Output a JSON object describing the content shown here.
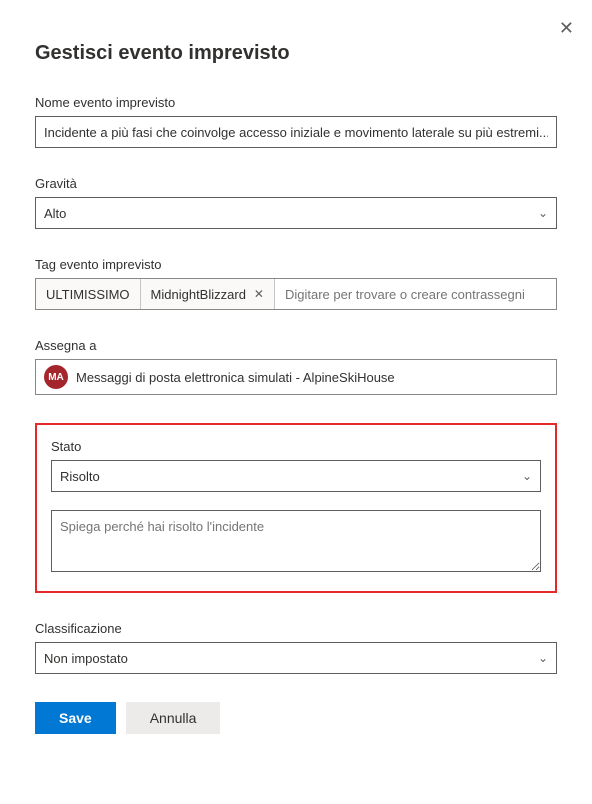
{
  "title": "Gestisci evento imprevisto",
  "name": {
    "label": "Nome evento imprevisto",
    "value": "Incidente a più fasi che coinvolge accesso iniziale e movimento laterale su più estremi..."
  },
  "severity": {
    "label": "Gravità",
    "value": "Alto"
  },
  "tags": {
    "label": "Tag evento imprevisto",
    "items": [
      "ULTIMISSIMO",
      "MidnightBlizzard"
    ],
    "placeholder": "Digitare per trovare o creare contrassegni"
  },
  "assign": {
    "label": "Assegna a",
    "avatar": "MA",
    "value": "Messaggi di posta elettronica simulati - AlpineSkiHouse"
  },
  "state": {
    "label": "Stato",
    "value": "Risolto",
    "reason_placeholder": "Spiega perché hai risolto l'incidente"
  },
  "classification": {
    "label": "Classificazione",
    "value": "Non impostato"
  },
  "buttons": {
    "save": "Save",
    "cancel": "Annulla"
  }
}
